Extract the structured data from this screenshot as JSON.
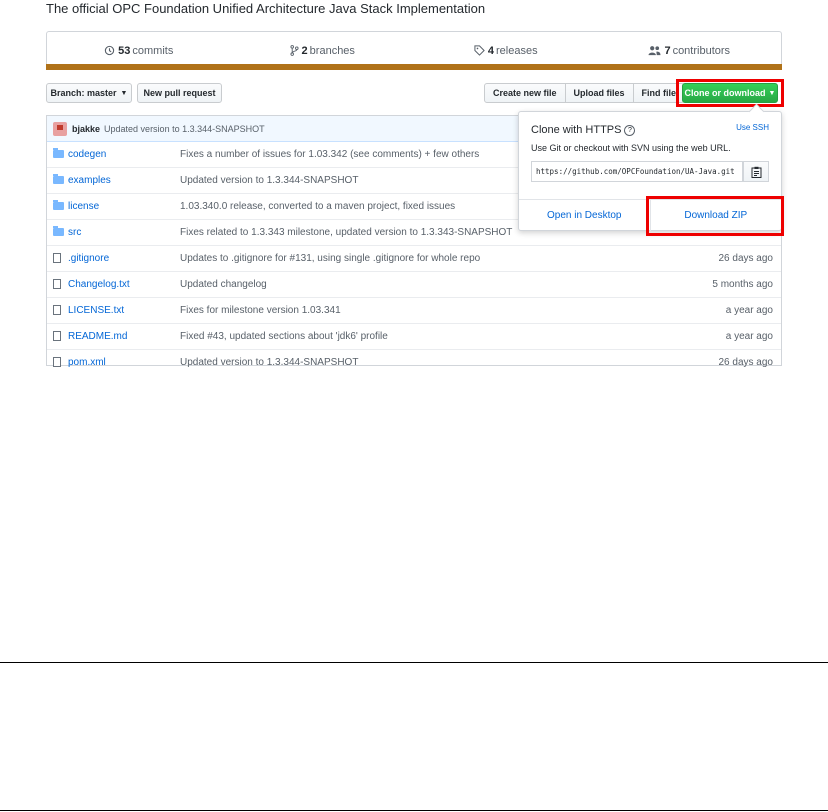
{
  "repo": {
    "description": "The official OPC Foundation Unified Architecture Java Stack Implementation"
  },
  "summary": {
    "commits_count": "53",
    "commits_label": "commits",
    "branches_count": "2",
    "branches_label": "branches",
    "releases_count": "4",
    "releases_label": "releases",
    "contributors_count": "7",
    "contributors_label": "contributors"
  },
  "colors": {
    "language_bar": "#b07219",
    "clone_button": "#28a745",
    "highlight": "#ee0000",
    "link": "#0366d6"
  },
  "toolbar": {
    "branch_label": "Branch: master",
    "new_pr_label": "New pull request",
    "create_file_label": "Create new file",
    "upload_label": "Upload files",
    "find_label": "Find file",
    "clone_label": "Clone or download"
  },
  "latest_commit": {
    "author": "bjakke",
    "message": "Updated version to 1.3.344-SNAPSHOT"
  },
  "files": [
    {
      "type": "folder-icon",
      "name": "codegen",
      "message": "Fixes a number of issues for 1.03.342 (see comments) + few others",
      "age": ""
    },
    {
      "type": "folder-icon",
      "name": "examples",
      "message": "Updated version to 1.3.344-SNAPSHOT",
      "age": ""
    },
    {
      "type": "folder-icon",
      "name": "license",
      "message": "1.03.340.0 release, converted to a maven project, fixed issues",
      "age": ""
    },
    {
      "type": "folder-icon",
      "name": "src",
      "message": "Fixes related to 1.3.343 milestone, updated version to 1.3.343-SNAPSHOT",
      "age": ""
    },
    {
      "type": "file-icon",
      "name": ".gitignore",
      "message": "Updates to .gitignore for #131, using single .gitignore for whole repo",
      "age": "26 days ago"
    },
    {
      "type": "file-icon",
      "name": "Changelog.txt",
      "message": "Updated changelog",
      "age": "5 months ago"
    },
    {
      "type": "file-icon",
      "name": "LICENSE.txt",
      "message": "Fixes for milestone version 1.03.341",
      "age": "a year ago"
    },
    {
      "type": "file-icon",
      "name": "README.md",
      "message": "Fixed #43, updated sections about 'jdk6' profile",
      "age": "a year ago"
    },
    {
      "type": "file-icon",
      "name": "pom.xml",
      "message": "Updated version to 1.3.344-SNAPSHOT",
      "age": "26 days ago"
    }
  ],
  "clone_popup": {
    "title": "Clone with HTTPS",
    "help_glyph": "?",
    "use_ssh_label": "Use SSH",
    "description": "Use Git or checkout with SVN using the web URL.",
    "url": "https://github.com/OPCFoundation/UA-Java.git",
    "open_desktop_label": "Open in Desktop",
    "download_zip_label": "Download ZIP"
  }
}
